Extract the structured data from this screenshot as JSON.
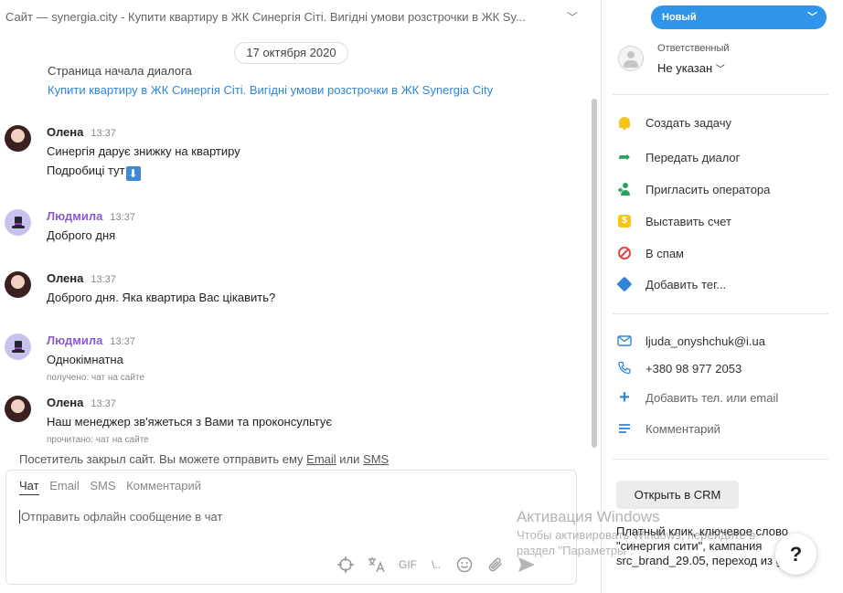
{
  "chat": {
    "title": "Сайт — synergia.city - Купити квартиру в ЖК Синергія Сіті. Вигідні умови розстрочки в ЖК Sy...",
    "date": "17 октября 2020",
    "start_page_label": "Страница начала диалога",
    "start_page_link": "Купити квартиру в ЖК Синергія Сіті. Вигідні умови розстрочки в ЖК Synergia City",
    "messages": [
      {
        "name": "Олена",
        "time": "13:37",
        "lines": [
          "Синергія дарує знижку на квартиру",
          "Подробиці тут"
        ],
        "emoji": "⬇",
        "status": ""
      },
      {
        "name": "Людмила",
        "time": "13:37",
        "lines": [
          "Доброго дня"
        ],
        "status": ""
      },
      {
        "name": "Олена",
        "time": "13:37",
        "lines": [
          "Доброго дня. Яка квартира Вас цікавить?"
        ],
        "status": ""
      },
      {
        "name": "Людмила",
        "time": "13:37",
        "lines": [
          "Однокімнатна"
        ],
        "status": "получено: чат на сайте"
      },
      {
        "name": "Олена",
        "time": "13:37",
        "lines": [
          "Наш менеджер зв'яжеться з Вами та проконсультує"
        ],
        "status": "прочитано: чат на сайте"
      }
    ],
    "closed_note_prefix": "Посетитель закрыл сайт. Вы можете отправить ему ",
    "closed_note_email": "Email",
    "closed_note_or": " или ",
    "closed_note_sms": "SMS"
  },
  "composer": {
    "tabs": [
      "Чат",
      "Email",
      "SMS",
      "Комментарий"
    ],
    "placeholder": "Отправить офлайн сообщение в чат",
    "tool_gif": "GIF",
    "tool_snippet": "\\..",
    "tools": [
      "crosshair-icon",
      "translate-icon",
      "gif-icon",
      "snippet-icon",
      "emoji-icon",
      "paperclip-icon",
      "send-icon"
    ]
  },
  "sidebar": {
    "status": "Новый",
    "responsible_label": "Ответственный",
    "responsible_value": "Не указан",
    "actions": [
      {
        "label": "Создать задачу",
        "icon": "bell-icon"
      },
      {
        "label": "Передать диалог",
        "icon": "forward-arrow-icon"
      },
      {
        "label": "Пригласить оператора",
        "icon": "add-person-icon"
      },
      {
        "label": "Выставить счет",
        "icon": "dollar-icon"
      },
      {
        "label": "В спам",
        "icon": "ban-icon"
      },
      {
        "label": "Добавить тег...",
        "icon": "tag-icon"
      }
    ],
    "contacts": [
      {
        "label": "ljuda_onyshchuk@i.ua",
        "icon": "mail-icon"
      },
      {
        "label": "+380 98 977 2053",
        "icon": "phone-icon"
      },
      {
        "label": "Добавить тел. или email",
        "icon": "plus-icon"
      },
      {
        "label": "Комментарий",
        "icon": "comment-lines-icon"
      }
    ],
    "crm_button": "Открыть в CRM",
    "source_text": "Платный клик, ключевое слово \"синергия сити\", кампания src_brand_29.05, переход из google"
  },
  "watermark": {
    "line1": "Активация Windows",
    "line2": "Чтобы активировать Windows, перейдите в",
    "line3": "раздел \"Параметры\"."
  },
  "help_label": "?",
  "colors": {
    "accent": "#2e95e8",
    "link": "#2f86d6",
    "lud_name": "#8a59d0",
    "green": "#2aa35a",
    "red": "#e84545",
    "yellow": "#f5c518"
  }
}
